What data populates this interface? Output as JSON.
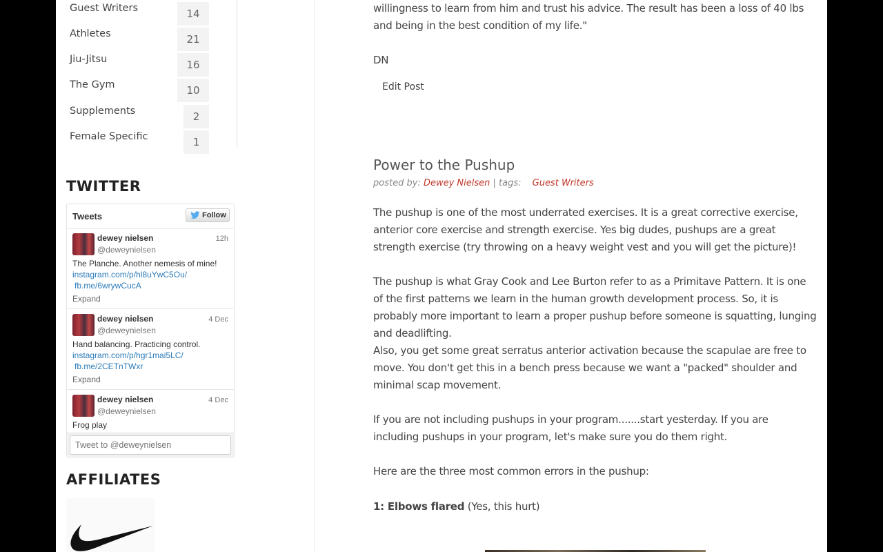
{
  "sidebar": {
    "categories": [
      {
        "label": "Guest Writers",
        "count": "14"
      },
      {
        "label": "Athletes",
        "count": "21"
      },
      {
        "label": "Jiu-Jitsu",
        "count": "16"
      },
      {
        "label": "The Gym",
        "count": "10"
      },
      {
        "label": "Supplements",
        "count": "2"
      },
      {
        "label": "Female Specific",
        "count": "1"
      }
    ],
    "twitter_heading": "TWITTER",
    "affiliates_heading": "AFFILIATES",
    "affiliate_logo_icon": "nike-swoosh-icon"
  },
  "twitter": {
    "title": "Tweets",
    "follow_label": "Follow",
    "follow_icon": "twitter-bird-icon",
    "tweets": [
      {
        "name": "dewey nielsen",
        "handle": "@deweynielsen",
        "time": "12h",
        "text": "The Planche. Another nemesis of mine!",
        "link1": "instagram.com/p/hl8uYwC5Ou/",
        "link2": "fb.me/6wrywCucA",
        "expand": "Expand"
      },
      {
        "name": "dewey nielsen",
        "handle": "@deweynielsen",
        "time": "4 Dec",
        "text": "Hand balancing. Practicing control.",
        "link1": "instagram.com/p/hgr1mai5LC/",
        "link2": "fb.me/2CETnTWxr",
        "expand": "Expand"
      },
      {
        "name": "dewey nielsen",
        "handle": "@deweynielsen",
        "time": "4 Dec",
        "text": "Frog play"
      }
    ],
    "compose_placeholder": "Tweet to @deweynielsen"
  },
  "previous_post": {
    "text": "willingness to learn from him and trust his advice. The result has been a loss of 40 lbs and being in the best condition of my life.\"",
    "signature": "DN",
    "edit_label": "Edit Post"
  },
  "post": {
    "title": "Power to the Pushup",
    "posted_by_label": "posted by:",
    "author": "Dewey Nielsen",
    "tags_label": "| tags:",
    "tag": "Guest Writers",
    "paragraphs": [
      "The pushup is one of the most underrated exercises. It is a great corrective exercise, anterior core exercise and strength exercise. Yes big dudes, pushups are a great strength exercise (try throwing on a heavy weight vest and you will get the picture)!",
      "The pushup is what Gray Cook and Lee Burton refer to as a Primitave Pattern. It is one of the first patterns we learn in the human growth development process. So, it is probably more important to learn a proper pushup before someone is squatting, lunging and deadlifting.",
      "Also, you get some great serratus anterior activation because the scapulae are free to move. You don't get this in a bench press because we want a \"packed\" shoulder and minimal scap movement.",
      "If you are not including pushups in your program.......start yesterday. If you are including pushups in your program, let's make sure you do them right.",
      "Here are the three most common errors in the pushup:"
    ],
    "error1_bold": "1: Elbows flared",
    "error1_rest": " (Yes, this hurt)"
  }
}
